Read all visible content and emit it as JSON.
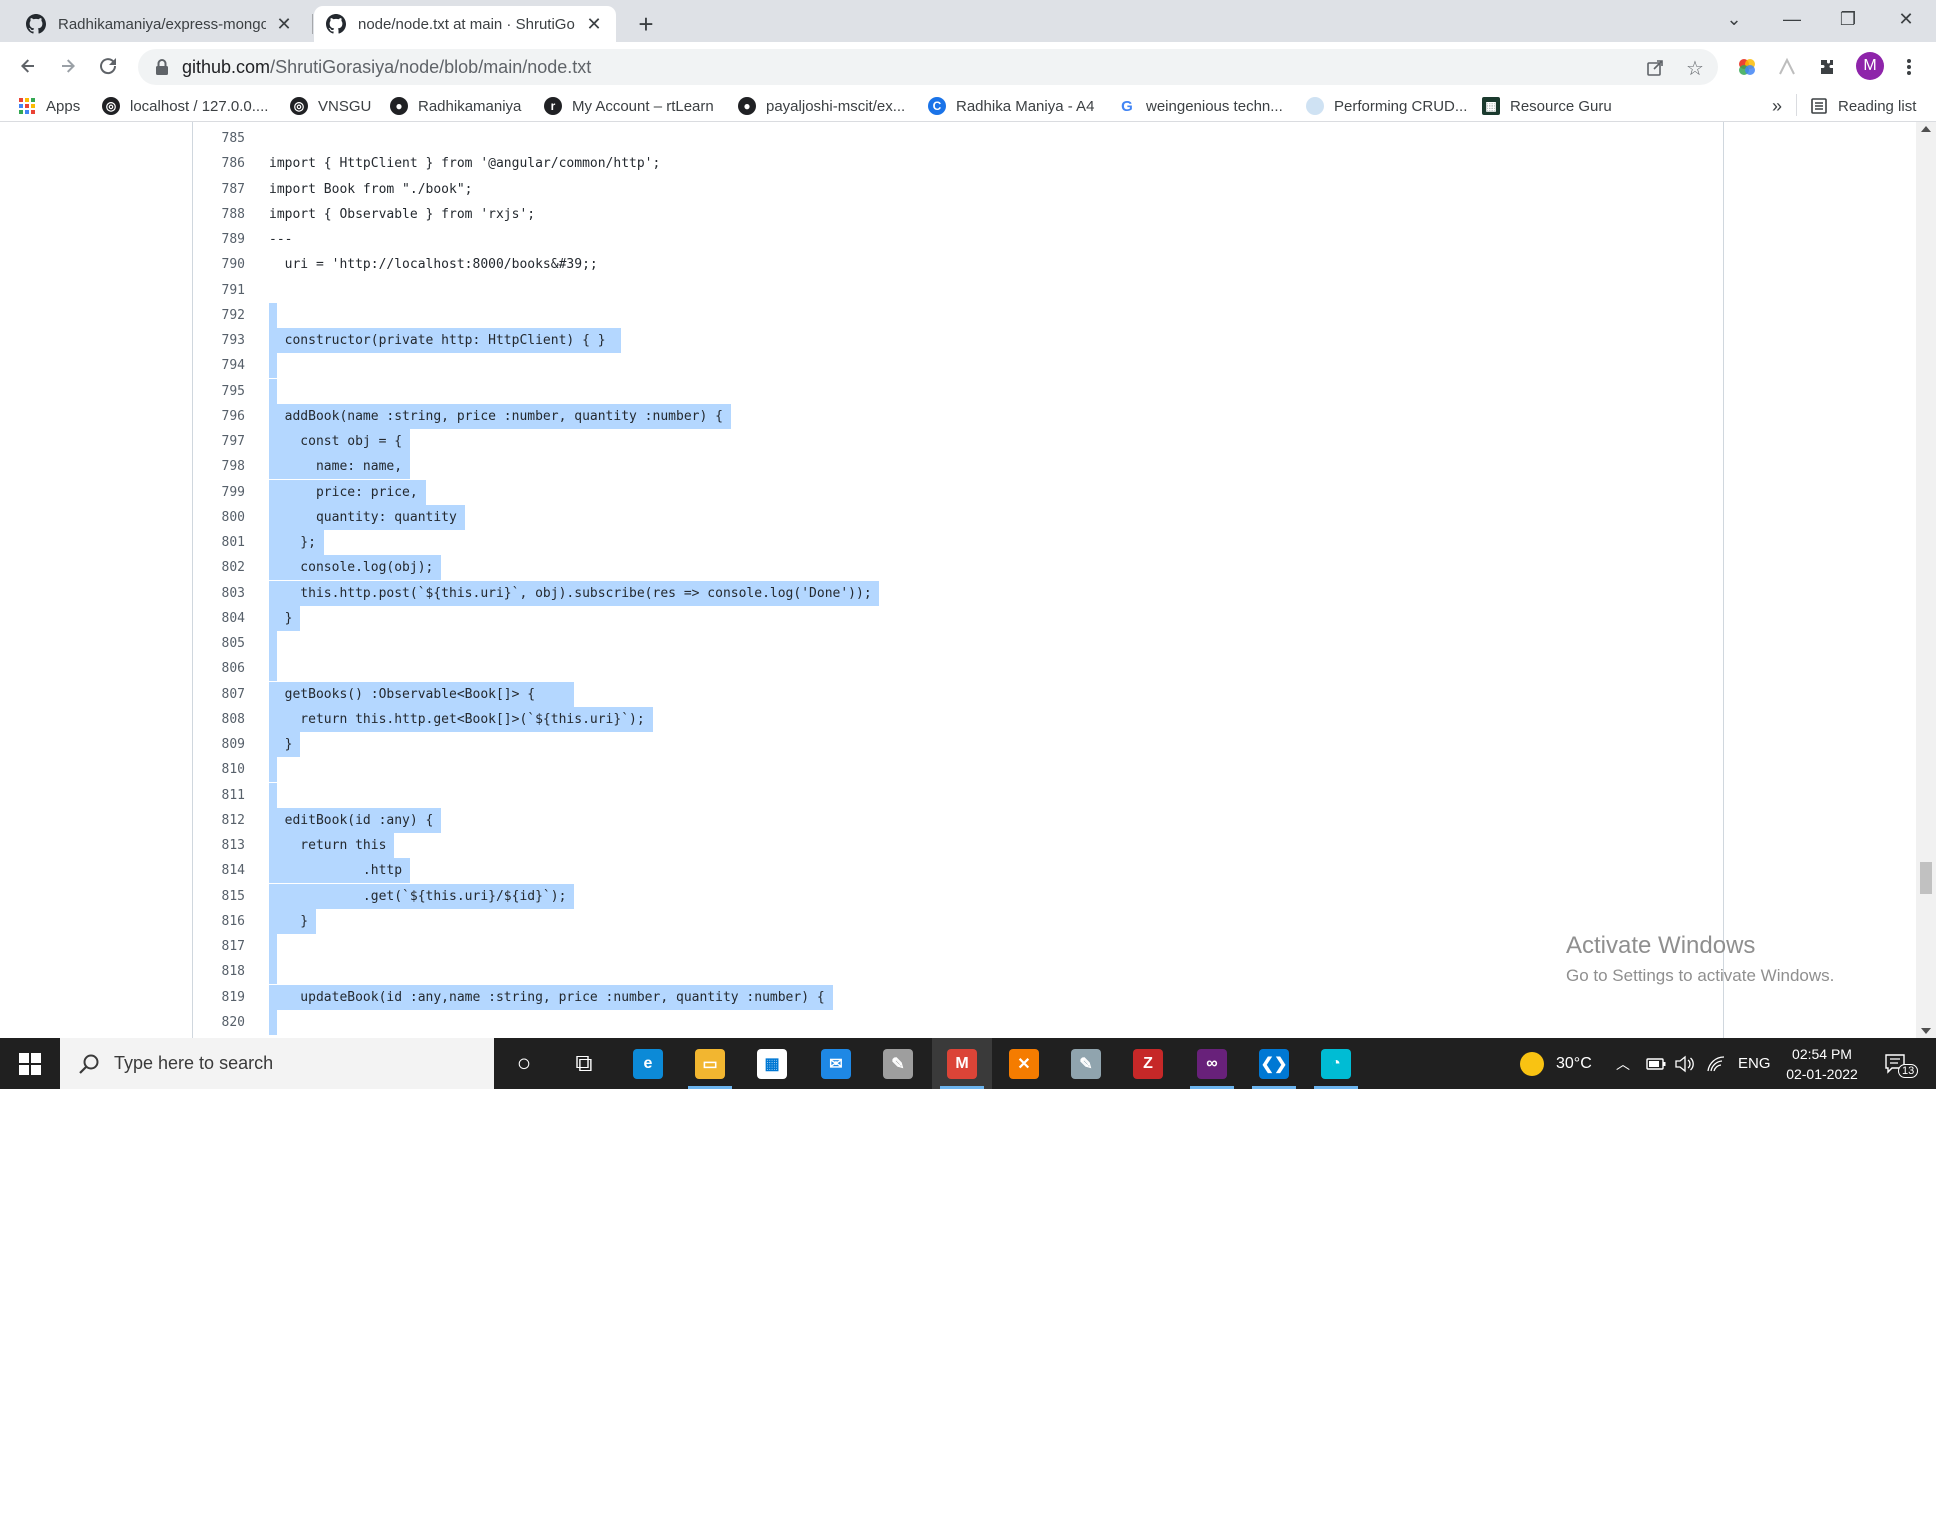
{
  "browser": {
    "tabs": [
      {
        "title": "Radhikamaniya/express-mongoo",
        "close": "✕",
        "active": false
      },
      {
        "title": "node/node.txt at main · ShrutiGo",
        "close": "✕",
        "active": true
      }
    ],
    "new_tab": "+",
    "window_controls": {
      "tab_search": "⌄",
      "minimize": "—",
      "restore": "❐",
      "close": "✕"
    },
    "url_host": "github.com",
    "url_path": "/ShrutiGorasiya/node/blob/main/node.txt",
    "bookmarks": [
      {
        "label": "Apps",
        "color": "#ea4335"
      },
      {
        "label": "localhost / 127.0.0....",
        "color": "#202124"
      },
      {
        "label": "VNSGU",
        "color": "#202124"
      },
      {
        "label": "Radhikamaniya",
        "color": "#202124"
      },
      {
        "label": "My Account – rtLearn",
        "color": "#202124"
      },
      {
        "label": "payaljoshi-mscit/ex...",
        "color": "#202124"
      },
      {
        "label": "Radhika Maniya - A4",
        "color": "#1a73e8"
      },
      {
        "label": "weingenious techn...",
        "color": "#4285f4"
      },
      {
        "label": "Performing CRUD...",
        "color": "#9fc5e8"
      },
      {
        "label": "Resource Guru",
        "color": "#1b3a2e"
      }
    ],
    "bookmarks_overflow": "»",
    "reading_list": "Reading list",
    "avatar_initial": "M"
  },
  "code": {
    "lines": [
      {
        "n": "785",
        "text": "",
        "sel": false
      },
      {
        "n": "786",
        "text": "import { HttpClient } from '@angular/common/http';",
        "sel": false
      },
      {
        "n": "787",
        "text": "import Book from \"./book\";",
        "sel": false
      },
      {
        "n": "788",
        "text": "import { Observable } from 'rxjs';",
        "sel": false
      },
      {
        "n": "789",
        "text": "---",
        "sel": false
      },
      {
        "n": "790",
        "text": "  uri = 'http://localhost:8000/books&#39;;",
        "sel": false
      },
      {
        "n": "791",
        "text": "",
        "sel": false
      },
      {
        "n": "792",
        "text": " ",
        "sel": true
      },
      {
        "n": "793",
        "text": "  constructor(private http: HttpClient) { }  ",
        "sel": true
      },
      {
        "n": "794",
        "text": " ",
        "sel": true
      },
      {
        "n": "795",
        "text": " ",
        "sel": true
      },
      {
        "n": "796",
        "text": "  addBook(name :string, price :number, quantity :number) { ",
        "sel": true
      },
      {
        "n": "797",
        "text": "    const obj = { ",
        "sel": true
      },
      {
        "n": "798",
        "text": "      name: name, ",
        "sel": true
      },
      {
        "n": "799",
        "text": "      price: price, ",
        "sel": true
      },
      {
        "n": "800",
        "text": "      quantity: quantity ",
        "sel": true
      },
      {
        "n": "801",
        "text": "    }; ",
        "sel": true
      },
      {
        "n": "802",
        "text": "    console.log(obj); ",
        "sel": true
      },
      {
        "n": "803",
        "text": "    this.http.post(`${this.uri}`, obj).subscribe(res => console.log('Done')); ",
        "sel": true
      },
      {
        "n": "804",
        "text": "  } ",
        "sel": true
      },
      {
        "n": "805",
        "text": " ",
        "sel": true
      },
      {
        "n": "806",
        "text": " ",
        "sel": true
      },
      {
        "n": "807",
        "text": "  getBooks() :Observable<Book[]> {     ",
        "sel": true
      },
      {
        "n": "808",
        "text": "    return this.http.get<Book[]>(`${this.uri}`); ",
        "sel": true
      },
      {
        "n": "809",
        "text": "  } ",
        "sel": true
      },
      {
        "n": "810",
        "text": " ",
        "sel": true
      },
      {
        "n": "811",
        "text": " ",
        "sel": true
      },
      {
        "n": "812",
        "text": "  editBook(id :any) { ",
        "sel": true
      },
      {
        "n": "813",
        "text": "    return this ",
        "sel": true
      },
      {
        "n": "814",
        "text": "            .http ",
        "sel": true
      },
      {
        "n": "815",
        "text": "            .get(`${this.uri}/${id}`); ",
        "sel": true
      },
      {
        "n": "816",
        "text": "    } ",
        "sel": true
      },
      {
        "n": "817",
        "text": " ",
        "sel": true
      },
      {
        "n": "818",
        "text": " ",
        "sel": true
      },
      {
        "n": "819",
        "text": "    updateBook(id :any,name :string, price :number, quantity :number) { ",
        "sel": true
      },
      {
        "n": "820",
        "text": " ",
        "sel": true
      }
    ]
  },
  "watermark": {
    "line1": "Activate Windows",
    "line2": "Go to Settings to activate Windows."
  },
  "taskbar": {
    "search_placeholder": "Type here to search",
    "weather": "30°C",
    "language": "ENG",
    "time": "02:54 PM",
    "date": "02-01-2022",
    "notification_count": "13",
    "apps": [
      {
        "name": "cortana",
        "glyph": "○",
        "color": "transparent"
      },
      {
        "name": "task-view",
        "glyph": "⧉",
        "color": "transparent"
      },
      {
        "name": "edge",
        "glyph": "e",
        "color": "#0c8ad7"
      },
      {
        "name": "file-explorer",
        "glyph": "▭",
        "color": "#f2b630"
      },
      {
        "name": "microsoft-store",
        "glyph": "▦",
        "color": "#ffffff"
      },
      {
        "name": "mail",
        "glyph": "✉",
        "color": "#1e88e5"
      },
      {
        "name": "paint",
        "glyph": "✎",
        "color": "#9e9e9e"
      },
      {
        "name": "chrome",
        "glyph": "M",
        "color": "#db4437"
      },
      {
        "name": "xampp",
        "glyph": "✕",
        "color": "#f57c00"
      },
      {
        "name": "notepad",
        "glyph": "✎",
        "color": "#90a4ae"
      },
      {
        "name": "filezilla",
        "glyph": "Z",
        "color": "#c62828"
      },
      {
        "name": "visual-studio",
        "glyph": "∞",
        "color": "#68217a"
      },
      {
        "name": "vscode",
        "glyph": "❮❯",
        "color": "#0078d4"
      },
      {
        "name": "timer-app",
        "glyph": "◔",
        "color": "#00bcd4"
      }
    ]
  }
}
